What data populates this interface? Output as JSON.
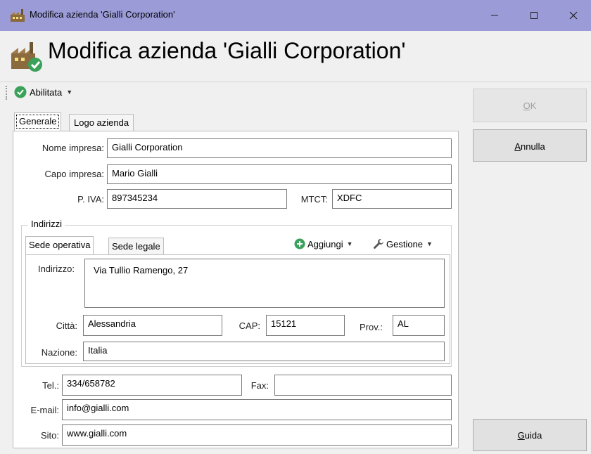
{
  "window": {
    "title": "Modifica azienda 'Gialli Corporation'",
    "controls": {
      "minimize": "—",
      "maximize": "☐",
      "close": "✕"
    }
  },
  "header": {
    "title": "Modifica azienda 'Gialli Corporation'"
  },
  "toolbar": {
    "status_label": "Abilitata",
    "status_icon": "check-circle-icon"
  },
  "tabs": {
    "generale": "Generale",
    "logo": "Logo azienda"
  },
  "form": {
    "nome_label": "Nome impresa:",
    "nome_value": "Gialli Corporation",
    "capo_label": "Capo impresa:",
    "capo_value": "Mario Gialli",
    "piva_label": "P. IVA:",
    "piva_value": "897345234",
    "mtct_label": "MTCT:",
    "mtct_value": "XDFC"
  },
  "indirizzi": {
    "legend": "Indirizzi",
    "tabs": {
      "operativa": "Sede operativa",
      "legale": "Sede legale"
    },
    "aggiungi_label": "Aggiungi",
    "gestione_label": "Gestione",
    "indirizzo_label": "Indirizzo:",
    "indirizzo_value": "Via Tullio Ramengo, 27",
    "citta_label": "Città:",
    "citta_value": "Alessandria",
    "cap_label": "CAP:",
    "cap_value": "15121",
    "prov_label": "Prov.:",
    "prov_value": "AL",
    "nazione_label": "Nazione:",
    "nazione_value": "Italia"
  },
  "contatti": {
    "tel_label": "Tel.:",
    "tel_value": "334/658782",
    "fax_label": "Fax:",
    "fax_value": "",
    "email_label": "E-mail:",
    "email_value": "info@gialli.com",
    "sito_label": "Sito:",
    "sito_value": "www.gialli.com"
  },
  "buttons": {
    "ok_first": "O",
    "ok_rest": "K",
    "annulla_first": "A",
    "annulla_rest": "nnulla",
    "guida_first": "G",
    "guida_rest": "uida"
  },
  "colors": {
    "titlebar": "#9b9bd8",
    "accent_green": "#3aa15a"
  }
}
